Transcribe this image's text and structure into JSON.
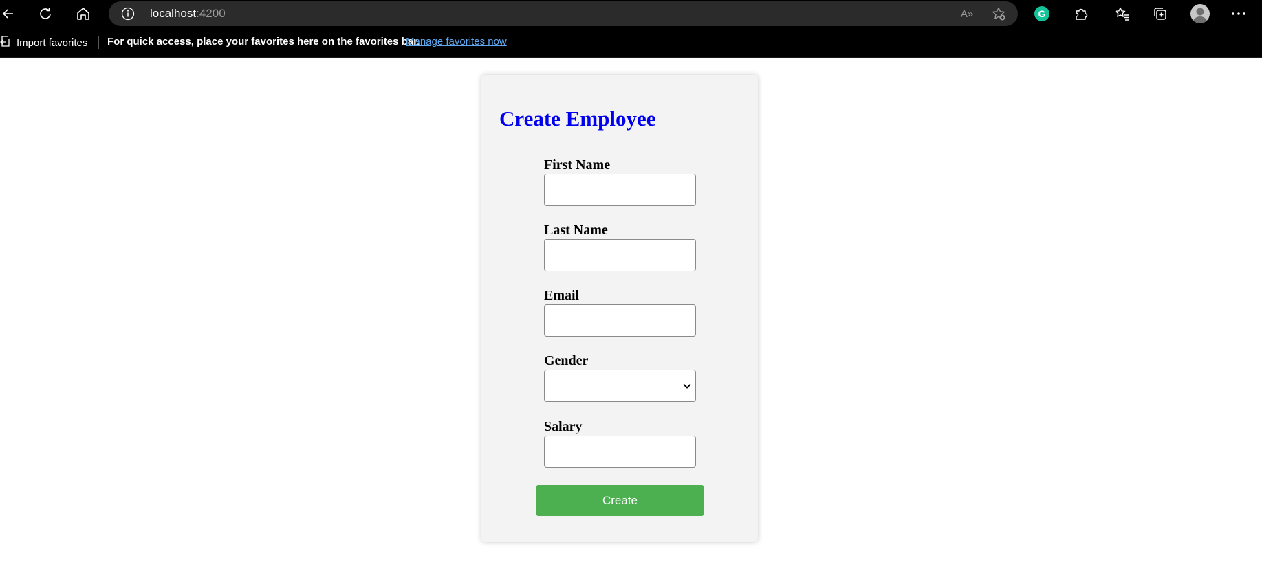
{
  "browser": {
    "address": {
      "host": "localhost",
      "port": ":4200"
    },
    "icons": {
      "back": "back-arrow-icon",
      "refresh": "refresh-icon",
      "home": "home-icon",
      "site_info": "info-icon",
      "read_aloud": "read-aloud-icon",
      "add_favorite": "add-favorite-icon",
      "grammarly": "grammarly-icon",
      "extensions": "puzzle-icon",
      "favorites": "favorites-icon",
      "collections": "collections-icon",
      "profile": "profile-avatar-icon",
      "more": "more-icon"
    },
    "grammarly_letter": "G",
    "read_aloud_text": "A»"
  },
  "favorites_bar": {
    "import_label": "Import favorites",
    "message": "For quick access, place your favorites here on the favorites bar.",
    "manage_link": "Manage favorites now"
  },
  "form": {
    "title": "Create Employee",
    "fields": [
      {
        "label": "First Name",
        "value": ""
      },
      {
        "label": "Last Name",
        "value": ""
      },
      {
        "label": "Email",
        "value": ""
      },
      {
        "label": "Gender",
        "value": ""
      },
      {
        "label": "Salary",
        "value": ""
      }
    ],
    "submit_label": "Create"
  },
  "colors": {
    "title": "#0000ee",
    "submit_bg": "#4caf50",
    "card_bg": "#f3f3f3",
    "link": "#5ea8f0",
    "grammarly": "#15c39a"
  }
}
